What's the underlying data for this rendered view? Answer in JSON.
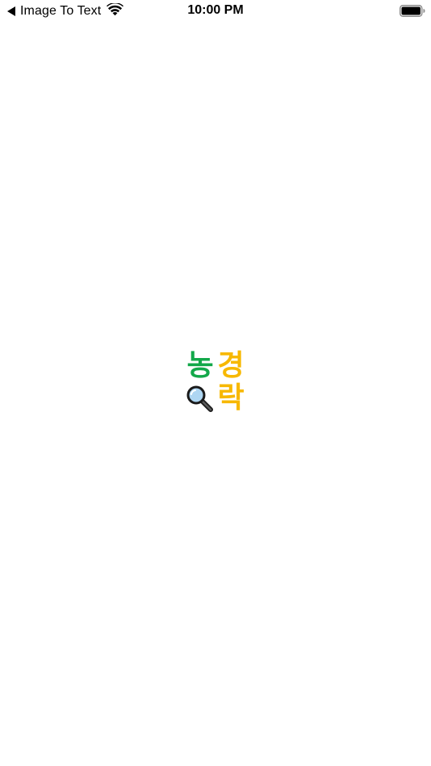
{
  "status_bar": {
    "back_label": "Image To Text",
    "time": "10:00 PM",
    "battery_icon": "battery-full-icon",
    "wifi_icon": "wifi-icon",
    "back_icon": "back-arrow-icon"
  },
  "logo": {
    "char_top_left": "농",
    "char_top_right": "경",
    "char_bottom_right": "락",
    "magnifier_icon": "magnifier-icon"
  },
  "colors": {
    "green": "#13a84a",
    "yellow": "#f7b800",
    "background": "#ffffff"
  }
}
